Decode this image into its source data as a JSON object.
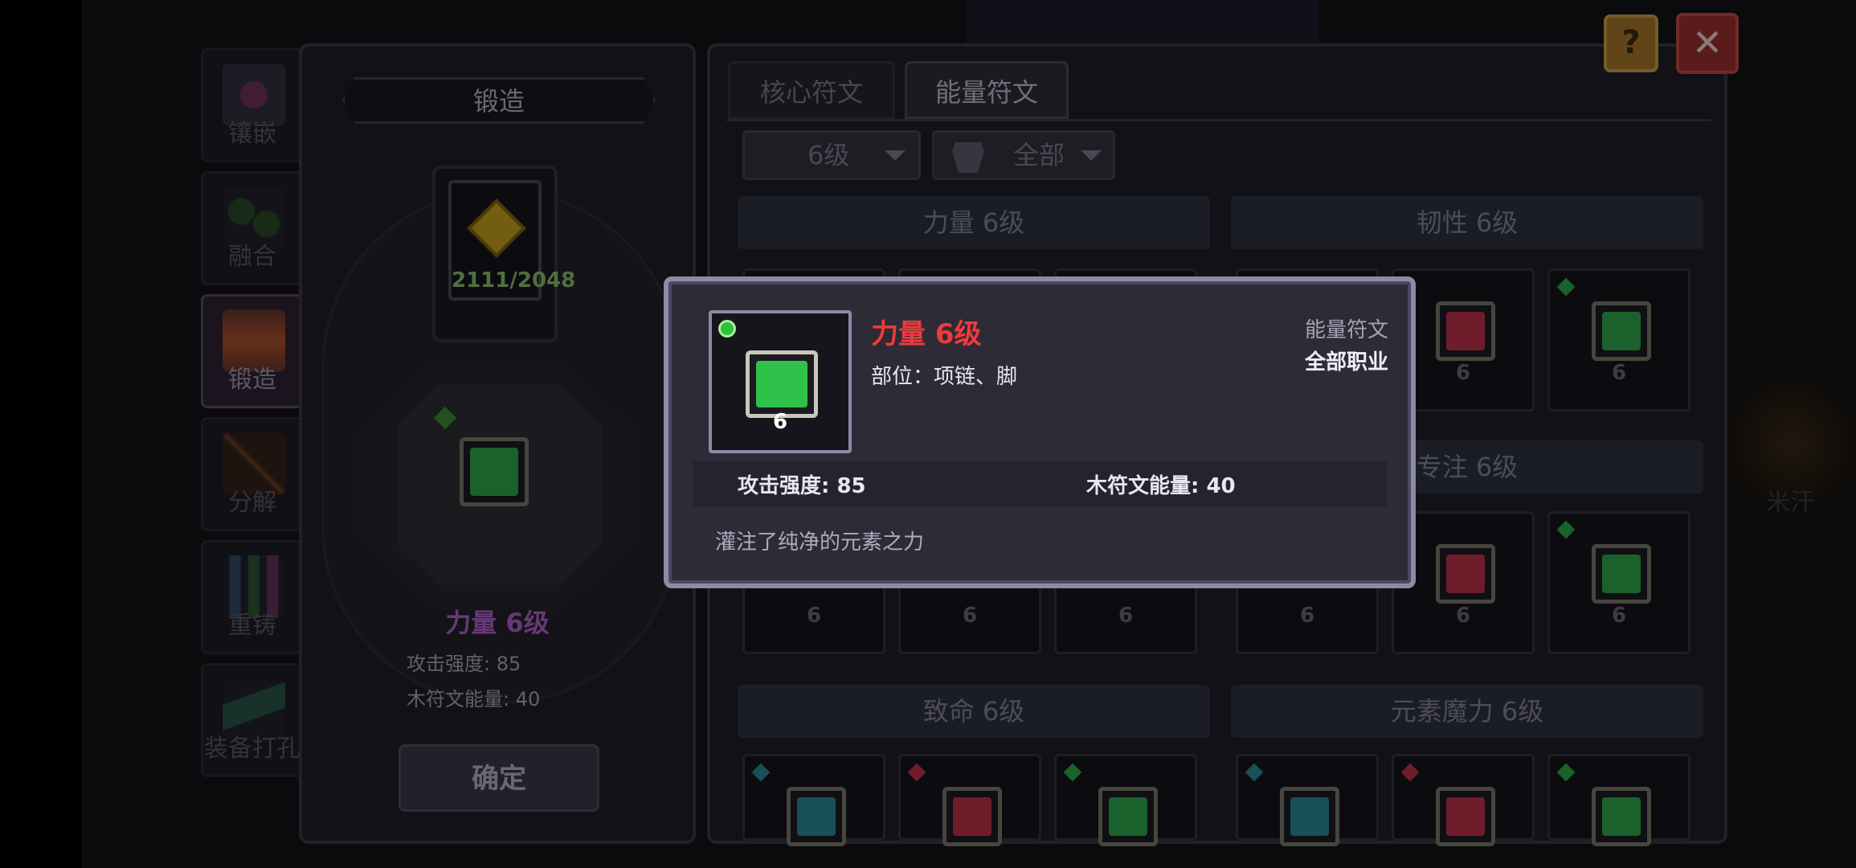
{
  "side_tabs": [
    {
      "label": "镶嵌",
      "icon": "inlay-icon",
      "active": false,
      "color": "#8a3a6a"
    },
    {
      "label": "融合",
      "icon": "fusion-icon",
      "active": false,
      "color": "#2f5a2a"
    },
    {
      "label": "锻造",
      "icon": "forge-icon",
      "active": true,
      "color": "#b8562a"
    },
    {
      "label": "分解",
      "icon": "decompose-icon",
      "active": false,
      "color": "#8a4a22"
    },
    {
      "label": "重铸",
      "icon": "recast-icon",
      "active": false,
      "color": "#3a5a82"
    },
    {
      "label": "装备打孔",
      "icon": "socket-icon",
      "active": false,
      "color": "#2f6a52"
    }
  ],
  "forge": {
    "title": "锻造",
    "material_count": "2111/2048",
    "rune_name": "力量 6级",
    "stats": [
      "攻击强度: 85",
      "木符文能量: 40"
    ],
    "confirm_label": "确定"
  },
  "rune_panel": {
    "tabs": [
      {
        "label": "核心符文",
        "active": false
      },
      {
        "label": "能量符文",
        "active": true
      }
    ],
    "level_filter": "6级",
    "class_filter": "全部",
    "sections": [
      {
        "label": "力量 6级"
      },
      {
        "label": "韧性 6级"
      },
      {
        "label": "专注 6级"
      },
      {
        "label": "致命 6级"
      },
      {
        "label": "元素魔力 6级"
      }
    ],
    "card_level": "6"
  },
  "background_text": "米汗",
  "buttons": {
    "help": "?",
    "close": "✕"
  },
  "tooltip": {
    "name": "力量 6级",
    "part": "部位：项链、脚",
    "type": "能量符文",
    "class": "全部职业",
    "stat1": "攻击强度: 85",
    "stat2": "木符文能量: 40",
    "description": "灌注了纯净的元素之力",
    "level": "6"
  },
  "colors": {
    "green_rune": "#2fb84a",
    "red_rune": "#c2324a",
    "teal_rune": "#2a8a9a",
    "tooltip_name": "#ef3b3b",
    "forge_name": "#b062c8"
  }
}
